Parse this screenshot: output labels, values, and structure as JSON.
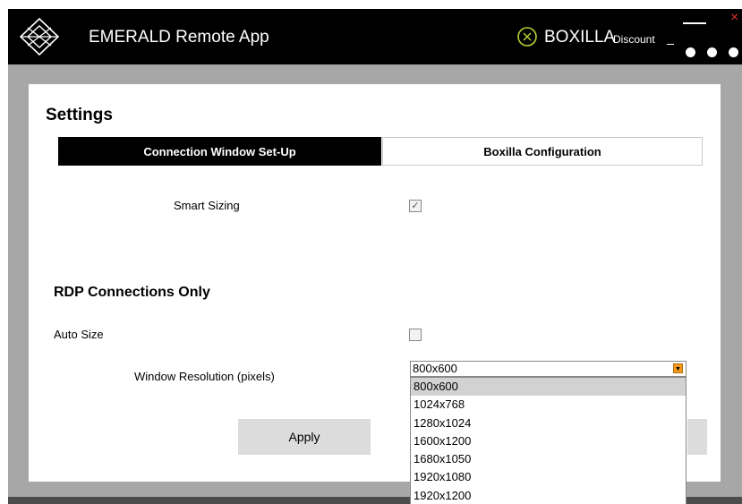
{
  "titlebar": {
    "title": "EMERALD Remote App",
    "boxilla_label": "BOXILLA",
    "discount_label": "Discount"
  },
  "settings": {
    "title": "Settings",
    "tabs": [
      {
        "label": "Connection Window Set-Up",
        "active": true
      },
      {
        "label": "Boxilla Configuration",
        "active": false
      }
    ],
    "smart_sizing": {
      "label": "Smart Sizing",
      "checked": true
    },
    "rdp_section_title": "RDP Connections Only",
    "auto_size": {
      "label": "Auto Size",
      "checked": false
    },
    "resolution": {
      "label": "Window Resolution (pixels)",
      "selected": "800x600",
      "options": [
        "800x600",
        "1024x768",
        "1280x1024",
        "1600x1200",
        "1680x1050",
        "1920x1080",
        "1920x1200"
      ]
    },
    "apply_label": "Apply"
  },
  "colors": {
    "titlebar": "#000000",
    "accent_orange": "#f39a1e",
    "boxilla_green": "#b5d334",
    "close_red": "#e03030",
    "frame_gray": "#a7a7a7"
  },
  "icons": [
    "diamond-logo-icon",
    "boxilla-x-icon",
    "minimize-icon",
    "close-icon",
    "more-dots-icon",
    "dropdown-arrow-icon"
  ]
}
